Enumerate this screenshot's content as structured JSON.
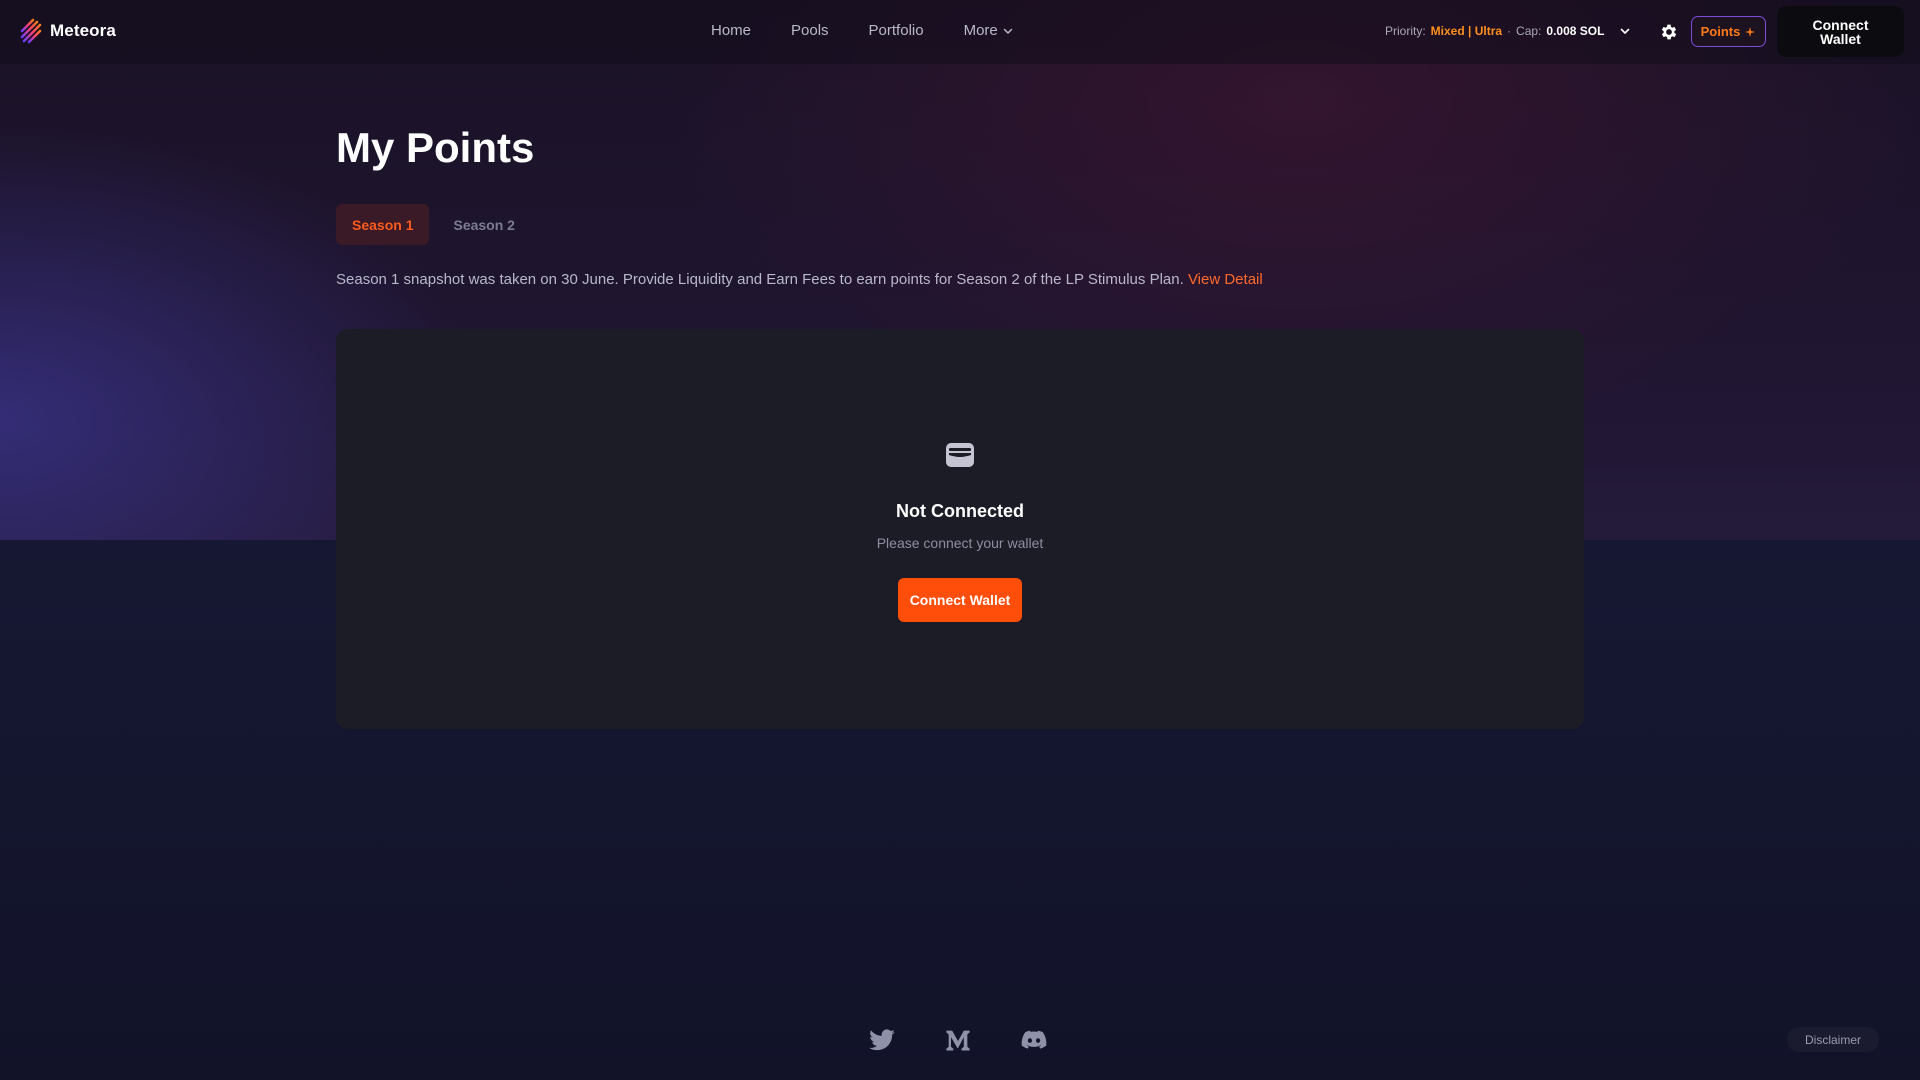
{
  "brand": {
    "name": "Meteora",
    "logo_icon": "meteora-logo-icon"
  },
  "nav": {
    "items": [
      {
        "label": "Home"
      },
      {
        "label": "Pools"
      },
      {
        "label": "Portfolio"
      },
      {
        "label": "More",
        "icon": "chevron-down-icon"
      }
    ]
  },
  "priority": {
    "label": "Priority:",
    "value": "Mixed | Ultra",
    "separator": "·",
    "cap_label": "Cap:",
    "cap_value": "0.008 SOL"
  },
  "header": {
    "settings_icon": "gear-icon",
    "points_label": "Points",
    "points_icon": "sparkle-icon",
    "connect_label": "Connect Wallet"
  },
  "main": {
    "title": "My Points",
    "tabs": [
      {
        "label": "Season 1",
        "active": true
      },
      {
        "label": "Season 2",
        "active": false
      }
    ],
    "description": "Season 1 snapshot was taken on 30 June. Provide Liquidity and Earn Fees to earn points for Season 2 of the LP Stimulus Plan.",
    "description_link": "View Detail"
  },
  "card": {
    "icon": "wallet-icon",
    "title": "Not Connected",
    "subtitle": "Please connect your wallet",
    "button_label": "Connect Wallet"
  },
  "footer": {
    "socials": [
      "twitter-icon",
      "medium-icon",
      "discord-icon"
    ],
    "disclaimer_label": "Disclaimer"
  },
  "colors": {
    "accent_orange": "#ff4d0a",
    "link_orange": "#ff6a2a",
    "priority_orange": "#ff8f1f",
    "points_border_purple": "#7d4bd6",
    "card_bg": "#1c1c27"
  }
}
